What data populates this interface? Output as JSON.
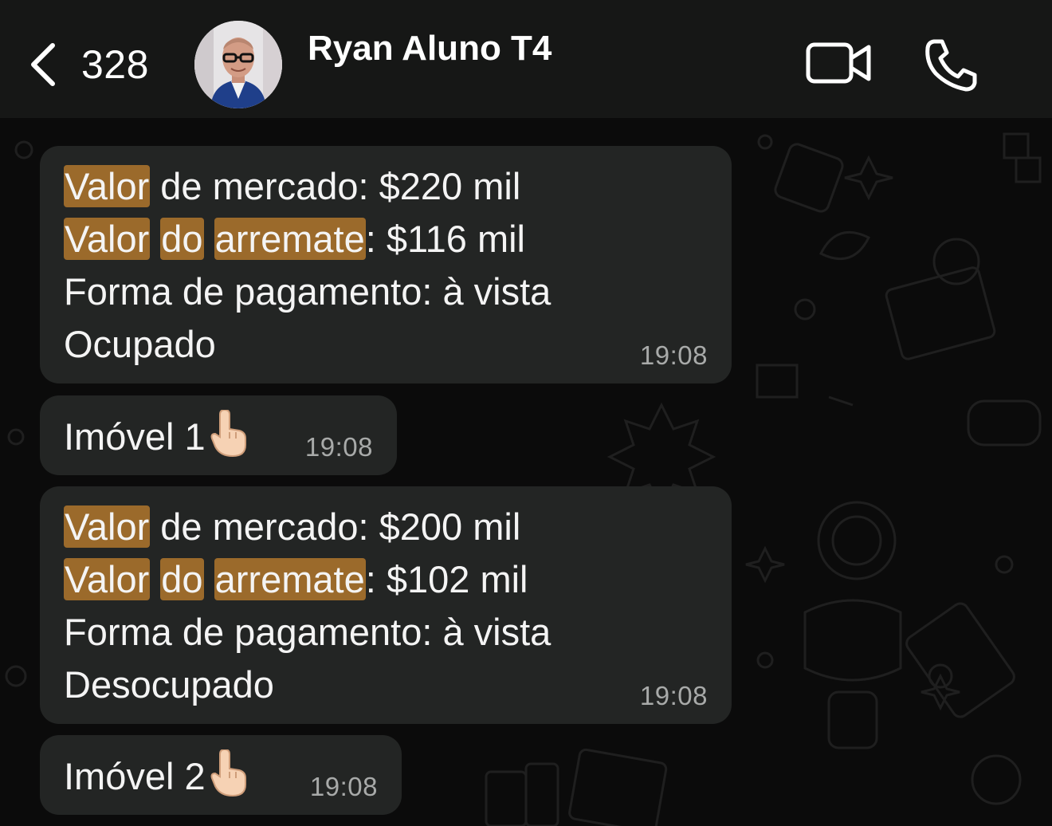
{
  "header": {
    "back_count": "328",
    "contact_name": "Ryan Aluno T4"
  },
  "messages": [
    {
      "lines": [
        {
          "hl1": "Valor",
          "rest": " de mercado: $220 mil"
        },
        {
          "hl1": "Valor",
          "hl2": "do",
          "hl3": "arremate",
          "rest": ": $116 mil"
        },
        {
          "text": "Forma de pagamento: à vista"
        },
        {
          "text": "Ocupado"
        }
      ],
      "time": "19:08"
    },
    {
      "text": "Imóvel 1",
      "emoji": "pointing-up-hand",
      "time": "19:08"
    },
    {
      "lines": [
        {
          "hl1": "Valor",
          "rest": " de mercado: $200 mil"
        },
        {
          "hl1": "Valor",
          "hl2": "do",
          "hl3": "arremate",
          "rest": ": $102 mil"
        },
        {
          "text": "Forma de pagamento: à vista"
        },
        {
          "text": "Desocupado"
        }
      ],
      "time": "19:08"
    },
    {
      "text": "Imóvel 2",
      "emoji": "pointing-up-hand",
      "time": "19:08"
    }
  ],
  "colors": {
    "header_bg": "#161716",
    "bubble_bg": "#232524",
    "highlight": "#9b6a2b",
    "time_text": "#a8aaa9"
  }
}
